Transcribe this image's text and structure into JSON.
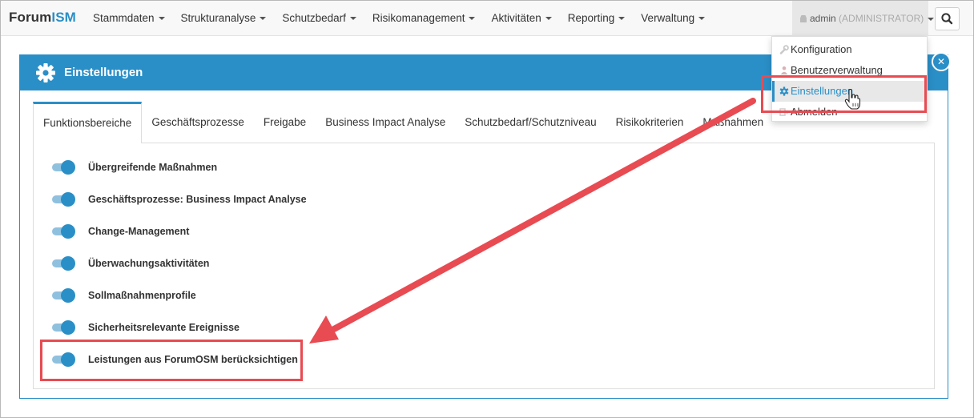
{
  "navbar": {
    "brand_main": "Forum",
    "brand_accent": "ISM",
    "items": [
      {
        "label": "Stammdaten"
      },
      {
        "label": "Strukturanalyse"
      },
      {
        "label": "Schutzbedarf"
      },
      {
        "label": "Risikomanagement"
      },
      {
        "label": "Aktivitäten"
      },
      {
        "label": "Reporting"
      },
      {
        "label": "Verwaltung"
      }
    ],
    "user_name": "admin",
    "user_role": "(ADMINISTRATOR)",
    "search_icon": "search-icon"
  },
  "user_dropdown": {
    "items": [
      {
        "label": "Konfiguration",
        "icon": "wrench-icon"
      },
      {
        "label": "Benutzerverwaltung",
        "icon": "users-icon"
      },
      {
        "label": "Einstellungen",
        "icon": "gear-icon",
        "active": true
      },
      {
        "label": "Abmelden",
        "icon": "sign-out-icon"
      }
    ]
  },
  "panel": {
    "title": "Einstellungen",
    "icon": "gear-icon",
    "close_icon": "close-icon"
  },
  "tabs": [
    {
      "label": "Funktionsbereiche",
      "active": true
    },
    {
      "label": "Geschäftsprozesse"
    },
    {
      "label": "Freigabe"
    },
    {
      "label": "Business Impact Analyse"
    },
    {
      "label": "Schutzbedarf/Schutzniveau"
    },
    {
      "label": "Risikokriterien"
    },
    {
      "label": "Maßnahmen"
    }
  ],
  "toggles": [
    {
      "label": "Übergreifende Maßnahmen",
      "on": true
    },
    {
      "label": "Geschäftsprozesse: Business Impact Analyse",
      "on": true
    },
    {
      "label": "Change-Management",
      "on": true
    },
    {
      "label": "Überwachungsaktivitäten",
      "on": true
    },
    {
      "label": "Sollmaßnahmenprofile",
      "on": true
    },
    {
      "label": "Sicherheitsrelevante Ereignisse",
      "on": true
    },
    {
      "label": "Leistungen aus ForumOSM berücksichtigen",
      "on": true
    }
  ],
  "colors": {
    "accent": "#2a8fc7",
    "annotation": "#e84b52",
    "toggle_track": "#8fc1df"
  }
}
